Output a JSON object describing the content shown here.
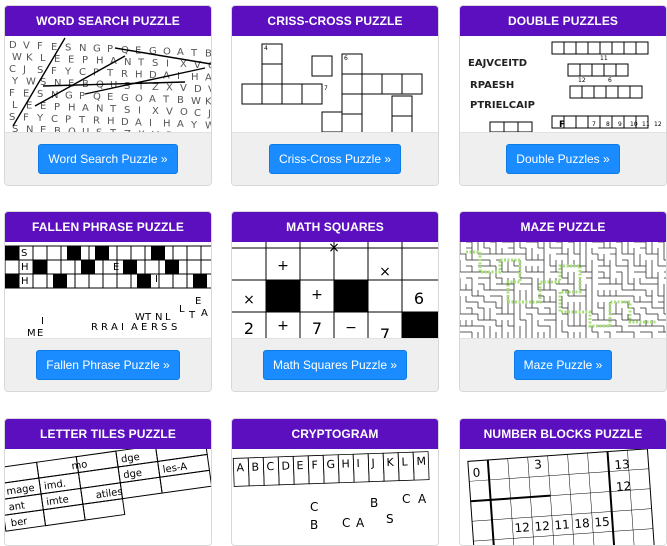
{
  "cards": [
    {
      "title": "WORD SEARCH PUZZLE",
      "button": "Word Search Puzzle »"
    },
    {
      "title": "CRISS-CROSS PUZZLE",
      "button": "Criss-Cross Puzzle »"
    },
    {
      "title": "DOUBLE PUZZLES",
      "button": "Double Puzzles »"
    },
    {
      "title": "FALLEN PHRASE PUZZLE",
      "button": "Fallen Phrase Puzzle »"
    },
    {
      "title": "MATH SQUARES",
      "button": "Math Squares Puzzle »"
    },
    {
      "title": "MAZE PUZZLE",
      "button": "Maze Puzzle »"
    },
    {
      "title": "LETTER TILES PUZZLE",
      "button": ""
    },
    {
      "title": "CRYPTOGRAM",
      "button": ""
    },
    {
      "title": "NUMBER BLOCKS PUZZLE",
      "button": ""
    }
  ],
  "previews": {
    "word_search_letters": "DVFESNGPQEGOATBWKLEEPHANTSIXVOCJSFYCPTRHDAIHAYWSNEBQUSTZXV",
    "double_words": [
      "EAJVCEITD",
      "RPAESH",
      "PTRIELCAIP"
    ],
    "double_marks": [
      "F",
      "11",
      "12",
      "6",
      "7",
      "8",
      "9",
      "10",
      "11",
      "12"
    ],
    "fallen_letters": [
      "S",
      "H",
      "H",
      "E",
      "I",
      "L",
      "E",
      "A",
      "T",
      "I",
      "W",
      "T",
      "N",
      "L",
      "M",
      "E",
      "R",
      "R",
      "A",
      "I",
      "A",
      "E",
      "R",
      "S",
      "S"
    ],
    "math_symbols": [
      "×",
      "+",
      "+",
      "×",
      "×",
      "+",
      "7",
      "−",
      "6",
      "2",
      "7"
    ],
    "letter_tiles": [
      "mo",
      "dge",
      "mage",
      "imd.",
      "dge",
      "ant",
      "imte",
      "atiles",
      "ber",
      "les-A"
    ],
    "cryptogram_alphabet": [
      "A",
      "B",
      "C",
      "D",
      "E",
      "F",
      "G",
      "H",
      "I",
      "J",
      "K",
      "L",
      "M"
    ],
    "cryptogram_letters": [
      "C",
      "B",
      "C",
      "A",
      "B",
      "C",
      "A",
      "S"
    ],
    "number_blocks": [
      "0",
      "3",
      "13",
      "12",
      "12",
      "12",
      "11",
      "18",
      "15"
    ]
  }
}
